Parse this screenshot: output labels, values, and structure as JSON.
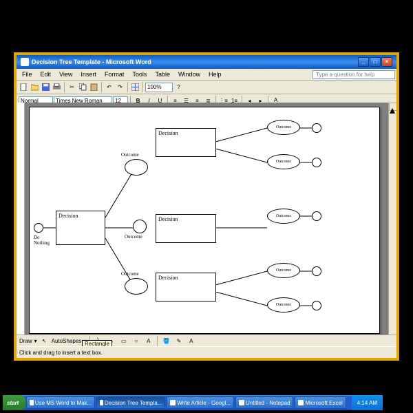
{
  "window": {
    "title": "Decision Tree Template - Microsoft Word"
  },
  "menu": {
    "file": "File",
    "edit": "Edit",
    "view": "View",
    "insert": "Insert",
    "format": "Format",
    "tools": "Tools",
    "table": "Table",
    "window": "Window",
    "help": "Help",
    "helpPlaceholder": "Type a question for help"
  },
  "format_toolbar": {
    "style": "Normal",
    "font": "Times New Roman",
    "size": "12",
    "zoom": "100%"
  },
  "draw_toolbar": {
    "draw": "Draw",
    "autoshapes": "AutoShapes",
    "tooltip": "Rectangle"
  },
  "status": {
    "hint": "Click and drag to insert a text box."
  },
  "taskbar": {
    "start": "start",
    "items": [
      "Use MS Word to Mak...",
      "Decision Tree Templa...",
      "Write Article - Googl...",
      "Untitled - Notepad",
      "Microsoft Excel"
    ],
    "time": "4:14 AM"
  },
  "diagram": {
    "doNothing": "Do\nNothing",
    "decision": "Decision",
    "outcome": "Outcome"
  }
}
